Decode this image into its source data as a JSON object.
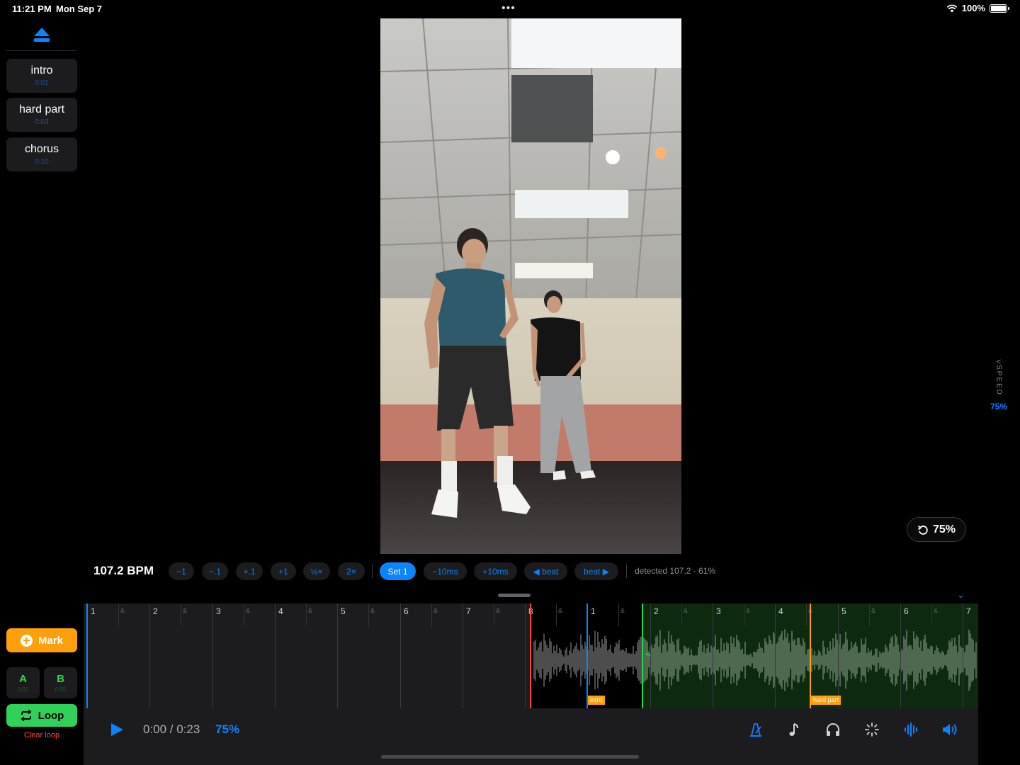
{
  "status": {
    "time": "11:21 PM",
    "date": "Mon Sep 7",
    "battery": "100%"
  },
  "markers": [
    {
      "label": "intro",
      "time": "0:01"
    },
    {
      "label": "hard part",
      "time": "0:03"
    },
    {
      "label": "chorus",
      "time": "0:10"
    }
  ],
  "controls": {
    "mark_label": "Mark",
    "a_label": "A",
    "a_time": "0:01",
    "b_label": "B",
    "b_time": "0:05",
    "loop_label": "Loop",
    "clear_loop_label": "Clear loop"
  },
  "speed": {
    "side_label": "SPEED",
    "side_value": "75%",
    "pill_value": "75%"
  },
  "bpm": {
    "value": "107.2 BPM",
    "buttons": [
      "−1",
      "−.1",
      "+.1",
      "+1",
      "½×",
      "2×",
      "Set 1",
      "−10ms",
      "+10ms",
      "◀ beat",
      "beat ▶"
    ],
    "detected": "detected 107.2 · 61%"
  },
  "timeline": {
    "bars": [
      "1",
      "2",
      "3",
      "4",
      "5",
      "6",
      "7",
      "8",
      "1",
      "2",
      "3",
      "4",
      "5",
      "6",
      "7"
    ],
    "subdivision": "&",
    "marker_intro": "intro",
    "marker_hard": "hard part",
    "loop_a": "A"
  },
  "transport": {
    "time": "0:00 / 0:23",
    "rate": "75%"
  },
  "colors": {
    "accent": "#0a84ff",
    "green": "#30d158",
    "orange": "#ff9f0a",
    "red": "#ff453a"
  }
}
